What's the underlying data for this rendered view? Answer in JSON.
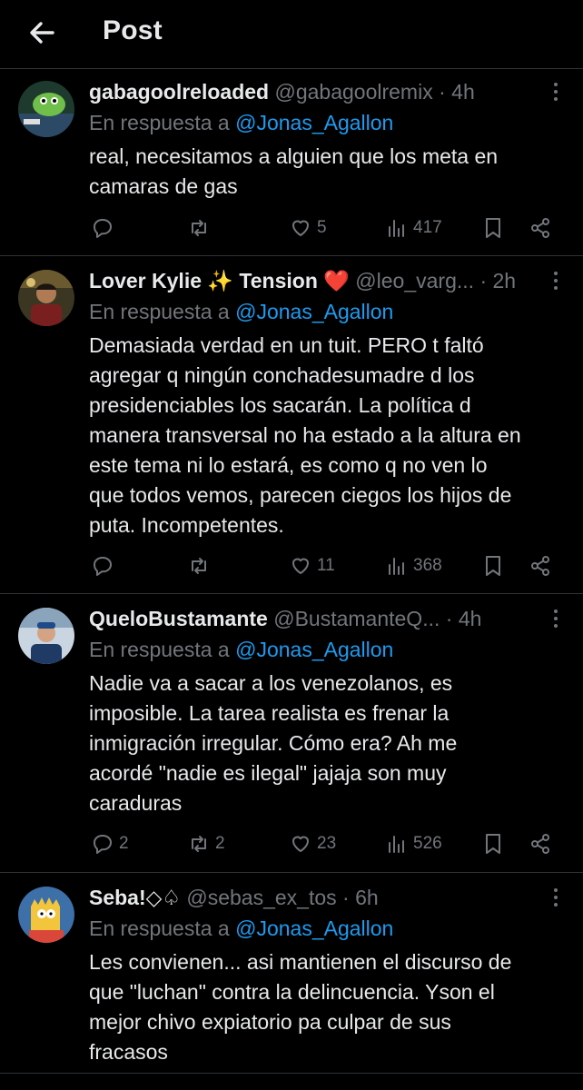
{
  "header": {
    "title": "Post"
  },
  "posts": [
    {
      "name": "gabagoolreloaded",
      "emoji": "",
      "handle": "@gabagoolremix",
      "sep": "·",
      "time": "4h",
      "reply_prefix": "En respuesta a",
      "reply_to": "@Jonas_Agallon",
      "text": "real, necesitamos a alguien que los meta en\ncamaras de gas",
      "replies": "",
      "reposts": "",
      "likes": "5",
      "views": "417",
      "avatar_colors": [
        "#2a4a3a",
        "#6fbf4a"
      ]
    },
    {
      "name": "Lover Kylie ✨ Tension ❤️",
      "emoji": "",
      "handle": "@leo_varg...",
      "sep": "·",
      "time": "2h",
      "reply_prefix": "En respuesta a",
      "reply_to": "@Jonas_Agallon",
      "text": "Demasiada verdad en un tuit. PERO t faltó\nagregar q ningún conchadesumadre d los\npresidenciables los sacarán. La política d\nmanera transversal no ha estado a la altura en\neste tema ni lo estará, es como q no ven lo\nque todos vemos, parecen ciegos los hijos de\nputa. Incompetentes.",
      "replies": "",
      "reposts": "",
      "likes": "11",
      "views": "368",
      "avatar_colors": [
        "#3b3a22",
        "#9a7a3a"
      ]
    },
    {
      "name": "QueloBustamante",
      "emoji": "",
      "handle": "@BustamanteQ...",
      "sep": "·",
      "time": "4h",
      "reply_prefix": "En respuesta a",
      "reply_to": "@Jonas_Agallon",
      "text": "Nadie va a sacar a los venezolanos, es\nimposible. La tarea realista es frenar la\ninmigración irregular. Cómo era? Ah me\nacordé \"nadie es ilegal\" jajaja son muy\ncaraduras",
      "replies": "2",
      "reposts": "2",
      "likes": "23",
      "views": "526",
      "avatar_colors": [
        "#9fb6cc",
        "#3a5a8a"
      ]
    },
    {
      "name": "Seba!◇♤",
      "emoji": "",
      "handle": "@sebas_ex_tos",
      "sep": "·",
      "time": "6h",
      "reply_prefix": "En respuesta a",
      "reply_to": "@Jonas_Agallon",
      "text": "Les convienen... asi mantienen el discurso de\nque \"luchan\" contra la delincuencia. Yson el\nmejor chivo expiatorio pa culpar de sus\nfracasos",
      "replies": "",
      "reposts": "",
      "likes": "",
      "views": "",
      "avatar_colors": [
        "#3d6fa8",
        "#f2c53d"
      ]
    }
  ]
}
